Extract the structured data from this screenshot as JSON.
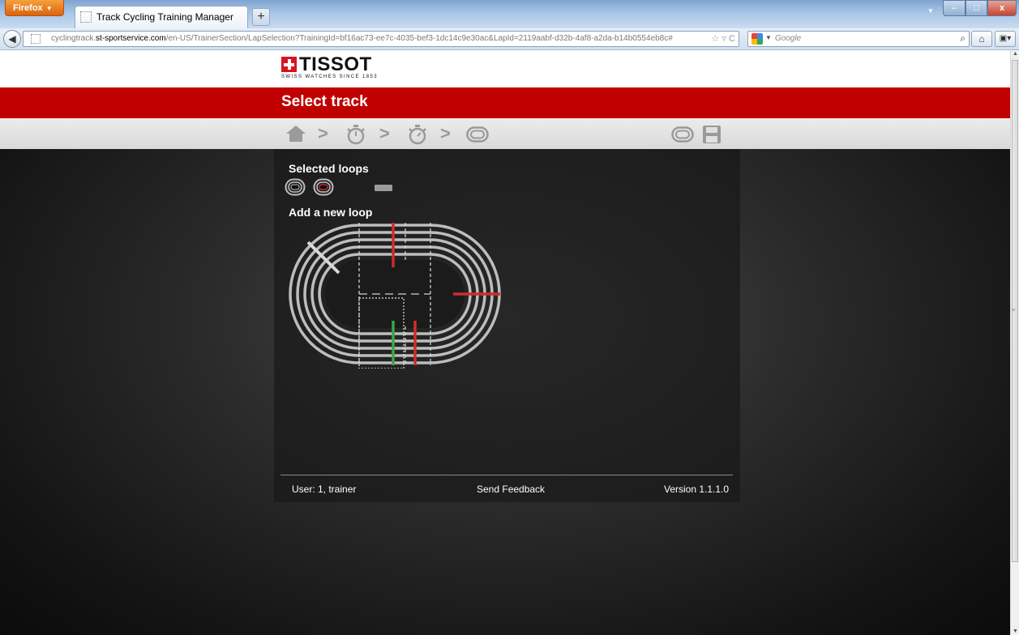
{
  "browser": {
    "app_button": "Firefox",
    "tab_title": "Track Cycling Training Manager",
    "url_prefix": "cyclingtrack.",
    "url_domain": "st-sportservice.com",
    "url_path": "/en-US/TrainerSection/LapSelection?TrainingId=bf16ac73-ee7c-4035-bef3-1dc14c9e30ac&LapId=2119aabf-d32b-4af8-a2da-b14b0554eb8c#",
    "search_placeholder": "Google"
  },
  "header": {
    "brand": "TISSOT",
    "tagline": "SWISS WATCHES SINCE 1853",
    "page_title": "Select track"
  },
  "breadcrumb": {
    "separator": ">",
    "steps": [
      "home-icon",
      "stopwatch-icon",
      "stopwatch-icon",
      "loop-icon"
    ],
    "actions": [
      "loop-icon",
      "save-icon"
    ]
  },
  "panel": {
    "selected_title": "Selected loops",
    "add_title": "Add a new loop"
  },
  "footer": {
    "user": "User: 1, trainer",
    "feedback": "Send Feedback",
    "version": "Version 1.1.1.0"
  },
  "colors": {
    "brand_red": "#c00000",
    "marker_red": "#d22b2b",
    "marker_green": "#3aa64a",
    "track_grey": "#bdbdbd"
  }
}
